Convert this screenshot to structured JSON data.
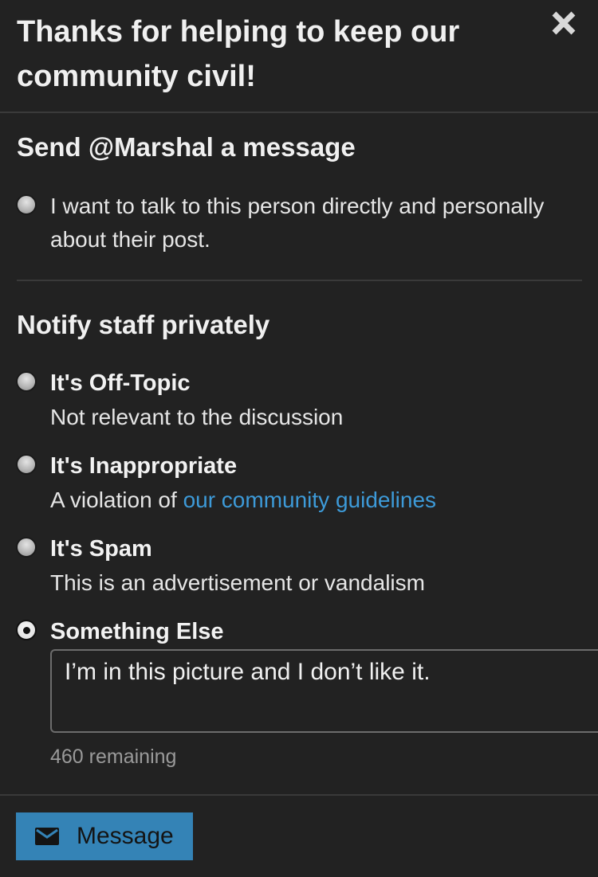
{
  "dialog": {
    "title": "Thanks for helping to keep our community civil!"
  },
  "send_message": {
    "heading": "Send @Marshal a message",
    "option_text": "I want to talk to this person directly and personally about their post."
  },
  "notify_staff": {
    "heading": "Notify staff privately",
    "options": [
      {
        "title": "It's Off-Topic",
        "description": "Not relevant to the discussion",
        "selected": false
      },
      {
        "title": "It's Inappropriate",
        "description_prefix": "A violation of ",
        "description_link": "our community guidelines",
        "selected": false
      },
      {
        "title": "It's Spam",
        "description": "This is an advertisement or vandalism",
        "selected": false
      },
      {
        "title": "Something Else",
        "selected": true
      }
    ],
    "message_value": "I’m in this picture and I don’t like it.",
    "remaining": "460 remaining"
  },
  "footer": {
    "button_label": "Message",
    "button_icon": "envelope-icon"
  },
  "colors": {
    "background": "#222222",
    "accent": "#3483b6",
    "link": "#3d9ad8"
  }
}
